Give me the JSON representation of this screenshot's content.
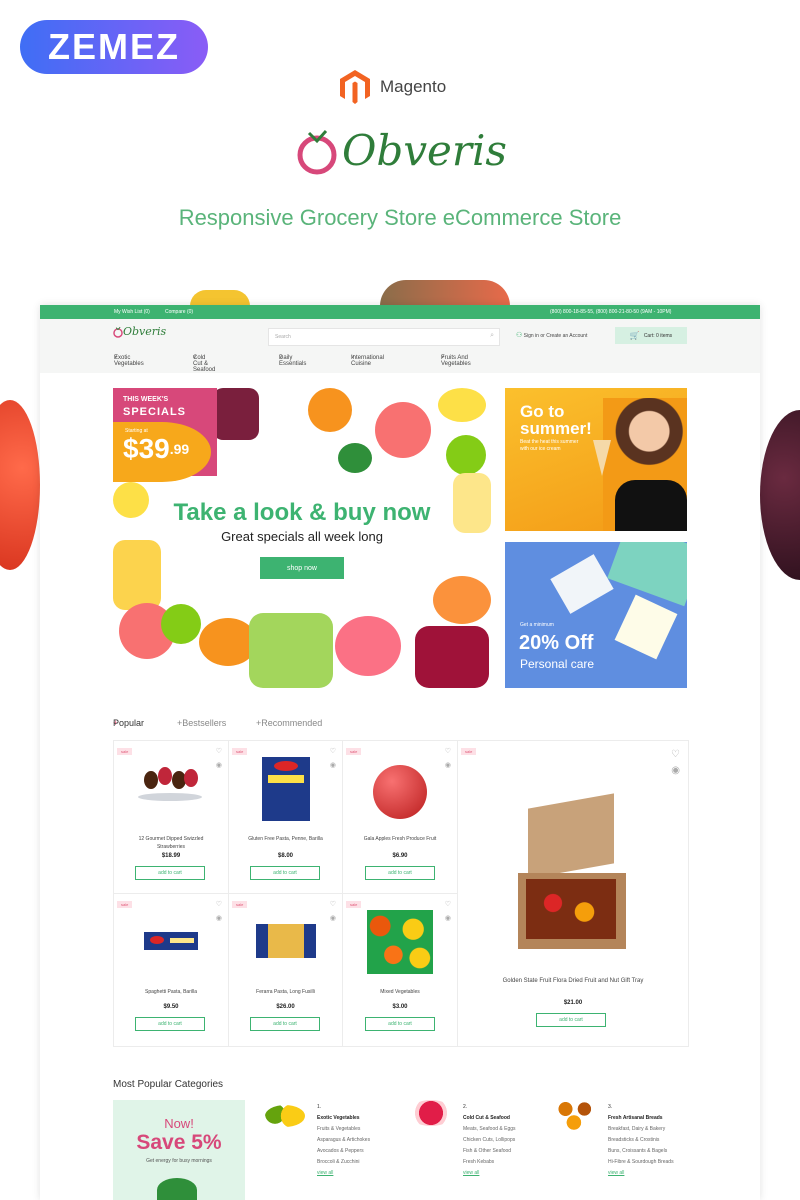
{
  "promo": {
    "brand": "ZEMEZ",
    "platform": "Magento",
    "logo_text": "Obveris",
    "tagline": "Responsive Grocery Store eCommerce Store"
  },
  "topbar": {
    "wishlist": "My Wish List (0)",
    "compare": "Compare (0)",
    "phones": "(800) 800-18-85-55, (800) 800-21-80-50 (9AM - 10PM)"
  },
  "header": {
    "logo_text": "Obveris",
    "search_placeholder": "Search",
    "signin": "Sign in",
    "or": "or",
    "create_account": "Create an Account",
    "cart": "Cart: 0 items"
  },
  "nav": [
    "Exotic Vegetables",
    "Cold Cut & Seafood",
    "Daily Essentials",
    "International Cuisine",
    "Fruits And Vegetables"
  ],
  "hero": {
    "badge_line1": "THIS WEEK'S",
    "badge_line2": "SPECIALS",
    "starting_at": "Starting at",
    "price_main": "$39",
    "price_cents": ".99",
    "title": "Take a look & buy now",
    "subtitle": "Great specials all week long",
    "button": "shop now"
  },
  "banner1": {
    "title_line1": "Go to",
    "title_line2": "summer!",
    "sub_line1": "Beat the heat this summer",
    "sub_line2": "with our ice cream"
  },
  "banner2": {
    "small": "Get a minimum",
    "big": "20% Off",
    "label": "Personal care"
  },
  "tabs": [
    "Popular",
    "Bestsellers",
    "Recommended"
  ],
  "sale_label": "sale",
  "add_to_cart": "add to cart",
  "products": [
    {
      "name_line1": "12 Gourmet Dipped Swizzled",
      "name_line2": "Strawberries",
      "price": "$18.99"
    },
    {
      "name_line1": "Gluten Free Pasta, Penne, Barilla",
      "name_line2": "",
      "price": "$8.00"
    },
    {
      "name_line1": "Gala Apples Fresh Produce Fruit",
      "name_line2": "",
      "price": "$6.90"
    },
    {
      "name_line1": "Spaghetti Pasta, Barilla",
      "name_line2": "",
      "price": "$9.50"
    },
    {
      "name_line1": "Ferarra Pasta, Long Fusilli",
      "name_line2": "",
      "price": "$26.00"
    },
    {
      "name_line1": "Mixed Vegetables",
      "name_line2": "",
      "price": "$3.00"
    }
  ],
  "featured": {
    "name": "Golden State Fruit Flora Dried Fruit and Nut Gift Tray",
    "price": "$21.00"
  },
  "categories": {
    "title": "Most Popular Categories",
    "promo_now": "Now!",
    "promo_save": "Save 5%",
    "promo_sub": "Get energy for busy mornings",
    "view_all": "view all",
    "items": [
      {
        "num": "1.",
        "title": "Exotic Vegetables",
        "links": [
          "Fruits & Vegetables",
          "Asparagus & Artichokes",
          "Avocados & Peppers",
          "Broccoli & Zucchini"
        ]
      },
      {
        "num": "2.",
        "title": "Cold Cut & Seafood",
        "links": [
          "Meats, Seafood & Eggs",
          "Chicken Cuts, Lollipops",
          "Fish & Other Seafood",
          "Fresh Kebabs"
        ]
      },
      {
        "num": "3.",
        "title": "Fresh Artisanal Breads",
        "links": [
          "Breakfast, Dairy & Bakery",
          "Breadsticks & Crostinis",
          "Buns, Croissants & Bagels",
          "Hi-Fibre & Sourdough Breads"
        ]
      }
    ]
  },
  "colors": {
    "accent": "#3db371",
    "pink": "#d7487a",
    "orange": "#f7a81b"
  }
}
